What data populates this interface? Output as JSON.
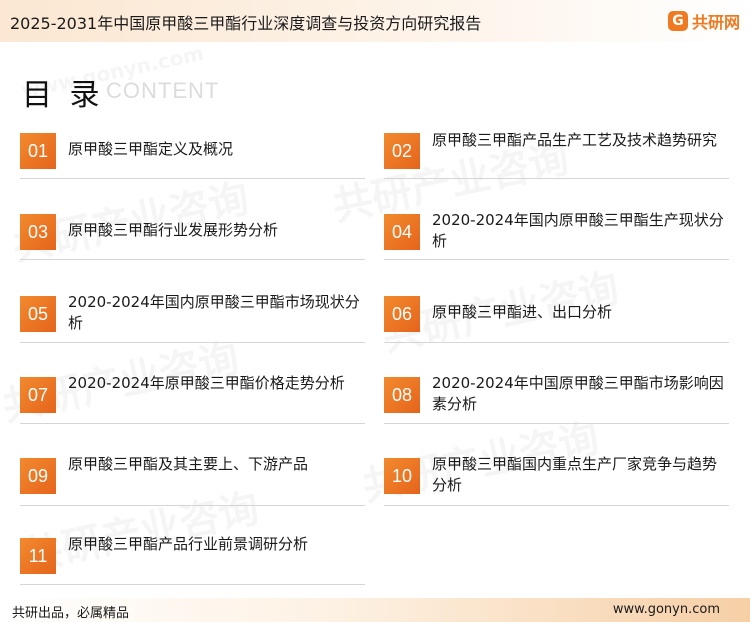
{
  "header": {
    "title": "2025-2031年中国原甲酸三甲酯行业深度调查与投资方向研究报告",
    "logo_mark": "G",
    "logo_text": "共研网"
  },
  "toc": {
    "title": "目 录",
    "subtitle": "CONTENT"
  },
  "watermark": {
    "url": "www.gonyn.com",
    "text": "共研产业咨询"
  },
  "items": [
    {
      "num": "01",
      "label": "原甲酸三甲酯定义及概况"
    },
    {
      "num": "02",
      "label": "原甲酸三甲酯产品生产工艺及技术趋势研究"
    },
    {
      "num": "03",
      "label": "原甲酸三甲酯行业发展形势分析"
    },
    {
      "num": "04",
      "label": "2020-2024年国内原甲酸三甲酯生产现状分析"
    },
    {
      "num": "05",
      "label": "2020-2024年国内原甲酸三甲酯市场现状分析"
    },
    {
      "num": "06",
      "label": "原甲酸三甲酯进、出口分析"
    },
    {
      "num": "07",
      "label": "2020-2024年原甲酸三甲酯价格走势分析"
    },
    {
      "num": "08",
      "label": "2020-2024年中国原甲酸三甲酯市场影响因素分析"
    },
    {
      "num": "09",
      "label": "原甲酸三甲酯及其主要上、下游产品"
    },
    {
      "num": "10",
      "label": "原甲酸三甲酯国内重点生产厂家竞争与趋势分析"
    },
    {
      "num": "11",
      "label": "原甲酸三甲酯产品行业前景调研分析"
    }
  ],
  "footer": {
    "left": "共研出品，必属精品",
    "right": "www.gonyn.com"
  }
}
